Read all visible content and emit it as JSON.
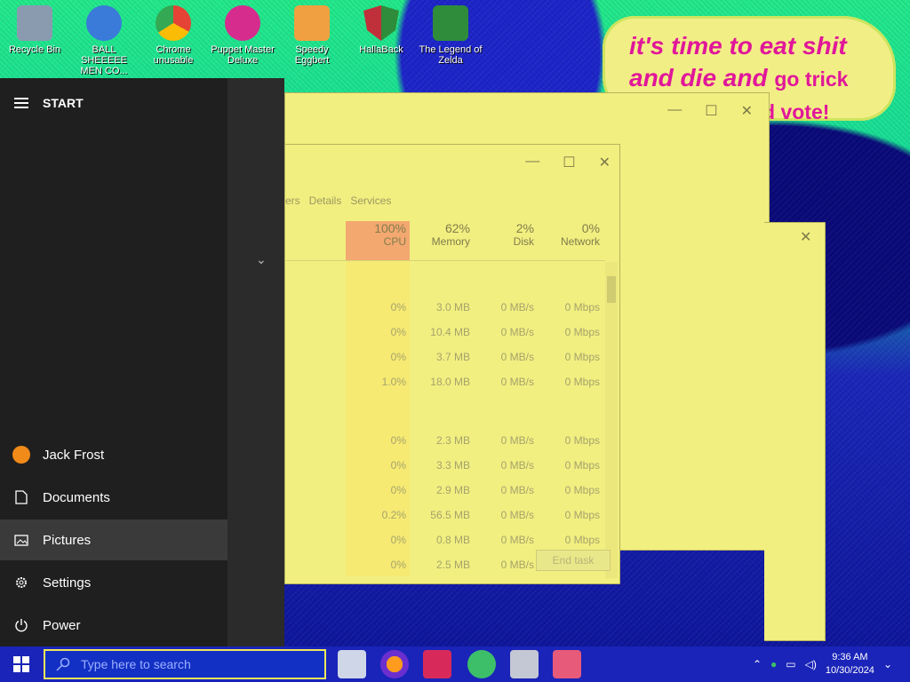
{
  "desktop": {
    "icons": [
      {
        "label": "Recycle Bin",
        "color": "#8a9bb0"
      },
      {
        "label": "BALL SHEEEEE MEN CO...",
        "color": "#3a7ad8"
      },
      {
        "label": "Chrome unusable",
        "color": "#e44336"
      },
      {
        "label": "Puppet Master Deluxe",
        "color": "#d62c8e"
      },
      {
        "label": "Speedy Eggbert",
        "color": "#f0a040"
      },
      {
        "label": "HallaBack",
        "color": "#c0303a"
      },
      {
        "label": "The Legend of Zelda",
        "color": "#2e8c3a"
      }
    ],
    "speech": {
      "line1": "it's time to eat shit",
      "line2a": "and die and",
      "line2b": "go trick",
      "line3": "d vote!"
    }
  },
  "task_manager": {
    "tabs": [
      "ers",
      "Details",
      "Services"
    ],
    "columns": [
      {
        "pct": "100%",
        "name": "CPU"
      },
      {
        "pct": "62%",
        "name": "Memory"
      },
      {
        "pct": "2%",
        "name": "Disk"
      },
      {
        "pct": "0%",
        "name": "Network"
      }
    ],
    "rows": [
      {
        "cpu": "0%",
        "mem": "3.0 MB",
        "disk": "0 MB/s",
        "net": "0 Mbps"
      },
      {
        "cpu": "0%",
        "mem": "10.4 MB",
        "disk": "0 MB/s",
        "net": "0 Mbps"
      },
      {
        "cpu": "0%",
        "mem": "3.7 MB",
        "disk": "0 MB/s",
        "net": "0 Mbps"
      },
      {
        "cpu": "1.0%",
        "mem": "18.0 MB",
        "disk": "0 MB/s",
        "net": "0 Mbps"
      },
      {
        "cpu": "0%",
        "mem": "2.3 MB",
        "disk": "0 MB/s",
        "net": "0 Mbps"
      },
      {
        "cpu": "0%",
        "mem": "3.3 MB",
        "disk": "0 MB/s",
        "net": "0 Mbps"
      },
      {
        "cpu": "0%",
        "mem": "2.9 MB",
        "disk": "0 MB/s",
        "net": "0 Mbps"
      },
      {
        "cpu": "0.2%",
        "mem": "56.5 MB",
        "disk": "0 MB/s",
        "net": "0 Mbps"
      },
      {
        "cpu": "0%",
        "mem": "0.8 MB",
        "disk": "0 MB/s",
        "net": "0 Mbps"
      },
      {
        "cpu": "0%",
        "mem": "2.5 MB",
        "disk": "0 MB/s",
        "net": "0 Mbps"
      }
    ],
    "end_task": "End task"
  },
  "start_menu": {
    "title": "START",
    "user": "Jack Frost",
    "items": [
      "Documents",
      "Pictures",
      "Settings",
      "Power"
    ]
  },
  "taskbar": {
    "search_placeholder": "Type here to search",
    "time": "9:36 AM",
    "date": "10/30/2024"
  }
}
